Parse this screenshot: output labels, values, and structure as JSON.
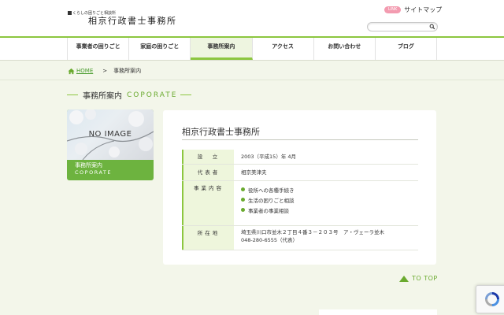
{
  "header": {
    "tagline": "くらしの困りごと相談所",
    "logo_text": "相京行政書士事務所",
    "link_badge": "LINK",
    "sitemap_label": "サイトマップ",
    "search_placeholder": ""
  },
  "nav": {
    "items": [
      "事業者の困りごと",
      "家庭の困りごと",
      "事務所案内",
      "アクセス",
      "お問い合わせ",
      "ブログ"
    ],
    "active_index": 2
  },
  "breadcrumb": {
    "home": "HOME",
    "separator": ">",
    "current": "事務所案内"
  },
  "section_title": {
    "ja": "事務所案内",
    "en": "COPORATE"
  },
  "sidebar_card": {
    "image_text": "NO IMAGE",
    "label_ja": "事務所案内",
    "label_en": "COPORATE"
  },
  "office": {
    "title": "相京行政書士事務所",
    "rows": {
      "established": {
        "label": "設　立",
        "value": "2003（平成15）年 4月"
      },
      "representative": {
        "label": "代表者",
        "value": "相京美津夫"
      },
      "services": {
        "label": "事業内容",
        "items": [
          "役所への各種手続き",
          "生活の困りごと相談",
          "事業者の事業相談"
        ]
      },
      "address": {
        "label": "所在地",
        "line1": "埼玉県川口市並木２丁目４番３－２０３号　ア・ヴェーラ並木",
        "line2": "048-280-6555（代表）"
      }
    }
  },
  "to_top": "TO TOP",
  "colors": {
    "accent": "#8cc63f",
    "accent_dark": "#6aaa2f",
    "background": "#f3f6ea",
    "badge": "#f39bb0"
  }
}
